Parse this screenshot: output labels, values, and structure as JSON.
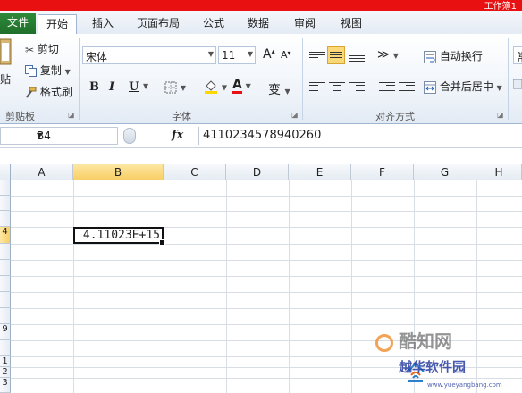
{
  "title_bar": {
    "text": "工作簿1"
  },
  "tabs": {
    "file": "文件",
    "items": [
      "开始",
      "插入",
      "页面布局",
      "公式",
      "数据",
      "审阅",
      "视图"
    ]
  },
  "clipboard": {
    "paste": "贴",
    "cut": "剪切",
    "copy": "复制",
    "format_painter": "格式刷",
    "group_label": "剪贴板"
  },
  "font": {
    "name": "宋体",
    "size": "11",
    "bold": "B",
    "italic": "I",
    "underline": "U",
    "grow": "A",
    "shrink": "A",
    "pinyin": "变",
    "font_color": "A",
    "group_label": "字体"
  },
  "alignment": {
    "wrap_text": "自动换行",
    "merge_center": "合并后居中",
    "group_label": "对齐方式"
  },
  "number": {
    "partial": "常"
  },
  "formula_bar": {
    "name_box": "B4",
    "fx": "fx",
    "value": "4110234578940260"
  },
  "sheet": {
    "columns": [
      "A",
      "B",
      "C",
      "D",
      "E",
      "F",
      "G",
      "H"
    ],
    "rows": [
      "",
      "",
      "",
      "4",
      "",
      "",
      "",
      "",
      "",
      "9",
      "",
      "1",
      "2",
      "3"
    ],
    "active_cell_value": "4.11023E+15"
  },
  "watermark": {
    "brand1": "酷知网",
    "brand2": "越华软件园",
    "url": "www.yueyangbang.com"
  },
  "colors": {
    "accent_red": "#e81010",
    "file_tab": "#1f6f2a",
    "selected_header": "#f8cf66"
  }
}
